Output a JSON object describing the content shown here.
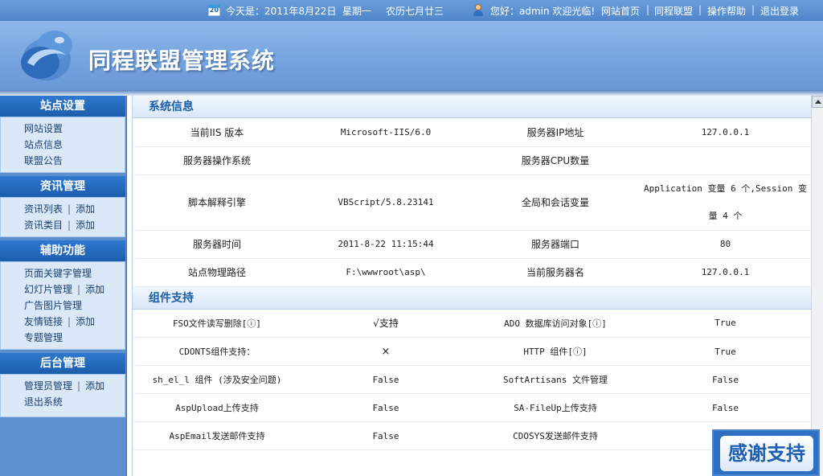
{
  "topbar": {
    "calendar_day": "20",
    "date_text": "今天是：2011年8月22日",
    "weekday": "星期一",
    "lunar": "农历七月廿三",
    "greeting": "您好：admin 欢迎光临!",
    "links": [
      "网站首页",
      "同程联盟",
      "操作帮助",
      "退出登录"
    ]
  },
  "header": {
    "title": "同程联盟管理系统"
  },
  "sidebar": {
    "groups": [
      {
        "title": "站点设置",
        "rows": [
          {
            "a": "网站设置"
          },
          {
            "a": "站点信息"
          },
          {
            "a": "联盟公告"
          }
        ]
      },
      {
        "title": "资讯管理",
        "rows": [
          {
            "a": "资讯列表",
            "b": "添加"
          },
          {
            "a": "资讯类目",
            "b": "添加"
          }
        ]
      },
      {
        "title": "辅助功能",
        "rows": [
          {
            "a": "页面关键字管理"
          },
          {
            "a": "幻灯片管理",
            "b": "添加"
          },
          {
            "a": "广告图片管理"
          },
          {
            "a": "友情链接",
            "b": "添加"
          },
          {
            "a": "专题管理"
          }
        ]
      },
      {
        "title": "后台管理",
        "rows": [
          {
            "a": "管理员管理",
            "b": "添加"
          },
          {
            "a": "退出系统"
          }
        ]
      }
    ],
    "separator": "|"
  },
  "system_info": {
    "title": "系统信息",
    "rows": [
      {
        "l1": "当前IIS 版本",
        "v1": "Microsoft-IIS/6.0",
        "l2": "服务器IP地址",
        "v2": "127.0.0.1"
      },
      {
        "l1": "服务器操作系统",
        "v1": "",
        "l2": "服务器CPU数量",
        "v2": ""
      },
      {
        "l1": "脚本解释引擎",
        "v1": "VBScript/5.8.23141",
        "l2": "全局和会话变量",
        "v2": "Application 变量 6 个,Session 变量 4 个"
      },
      {
        "l1": "服务器时间",
        "v1": "2011-8-22 11:15:44",
        "l2": "服务器端口",
        "v2": "80"
      },
      {
        "l1": "站点物理路径",
        "v1": "F:\\wwwroot\\asp\\",
        "l2": "当前服务器名",
        "v2": "127.0.0.1"
      }
    ]
  },
  "components": {
    "title": "组件支持",
    "rows": [
      {
        "l1": "FSO文件读写删除[ⓘ]",
        "v1": "√支持",
        "l2": "ADO 数据库访问对象[ⓘ]",
        "v2": "True"
      },
      {
        "l1": "CDONTS组件支持：",
        "v1": "×",
        "l2": "HTTP 组件[ⓘ]",
        "v2": "True"
      },
      {
        "l1": "sh_el_l 组件 (涉及安全问题)",
        "v1": "False",
        "l2": "SoftArtisans 文件管理",
        "v2": "False"
      },
      {
        "l1": "AspUpload上传支持",
        "v1": "False",
        "l2": "SA-FileUp上传支持",
        "v2": "False"
      },
      {
        "l1": "AspEmail发送邮件支持",
        "v1": "False",
        "l2": "CDOSYS发送邮件支持",
        "v2": ""
      }
    ]
  },
  "thanks_label": "感谢支持"
}
